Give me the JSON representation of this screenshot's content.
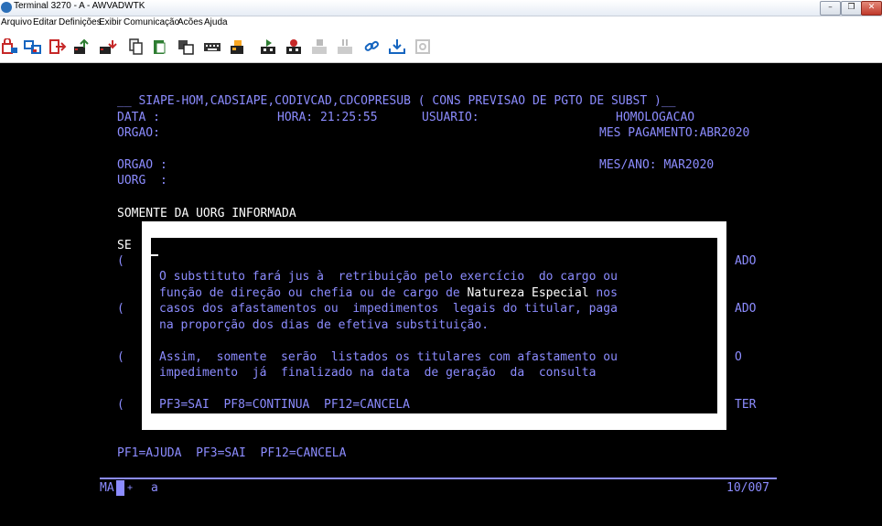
{
  "window": {
    "title": "Terminal 3270 - A - AWVADWTK",
    "min_glyph": "–",
    "max_glyph": "❐",
    "close_glyph": "✕"
  },
  "menu": [
    "Arquivo",
    "Editar",
    "Definições",
    "Exibir",
    "Comunicação",
    "Acões",
    "Ajuda"
  ],
  "toolbar_icons": [
    "disconnect-icon",
    "connect-icon",
    "exit-icon",
    "send-file-icon",
    "receive-file-icon",
    "copy-icon",
    "paste-icon",
    "print-icon",
    "keyboard-icon",
    "macro-icon",
    "play-macro-icon",
    "record-macro-icon",
    "stop-macro-icon",
    "pause-macro-icon",
    "link-icon",
    "download-icon",
    "settings-icon"
  ],
  "screen": {
    "header": "__ SIAPE-HOM,CADSIAPE,CODIVCAD,CDCOPRESUB ( CONS PREVISAO DE PGTO DE SUBST )__",
    "data_label": "DATA :",
    "hora": "HORA: 21:25:55",
    "usuario_label": "USUARIO:",
    "ambiente": "HOMOLOGACAO",
    "orgao1": "ORGAO:",
    "mes_pagamento": "MES PAGAMENTO:ABR2020",
    "orgao2": "ORGAO :",
    "mes_ano": "MES/ANO: MAR2020",
    "uorg": "UORG  :",
    "somente": "SOMENTE DA UORG INFORMADA",
    "se": "SE",
    "paren": "(",
    "right_col": [
      "ADO",
      "ADO",
      "O",
      "TER"
    ],
    "pf_bottom": "PF1=AJUDA  PF3=SAI  PF12=CANCELA",
    "status_left": "MA",
    "status_plus": "+",
    "status_a": "a",
    "status_right": "10/007"
  },
  "popup": {
    "line1": "O substituto fará jus à  retribuição pelo exercício  do cargo ou",
    "line2_a": "função de direção ou chefia ou de cargo de ",
    "line2_b": "Natureza Especial",
    "line2_c": " nos",
    "line3": "casos dos afastamentos ou  impedimentos  legais do titular, paga",
    "line4": "na proporção dos dias de efetiva substituição.",
    "line5": "Assim,  somente  serão  listados os titulares com afastamento ou",
    "line6": "impedimento  já  finalizado na data  de geração  da  consulta",
    "keys": "PF3=SAI  PF8=CONTINUA  PF12=CANCELA"
  }
}
